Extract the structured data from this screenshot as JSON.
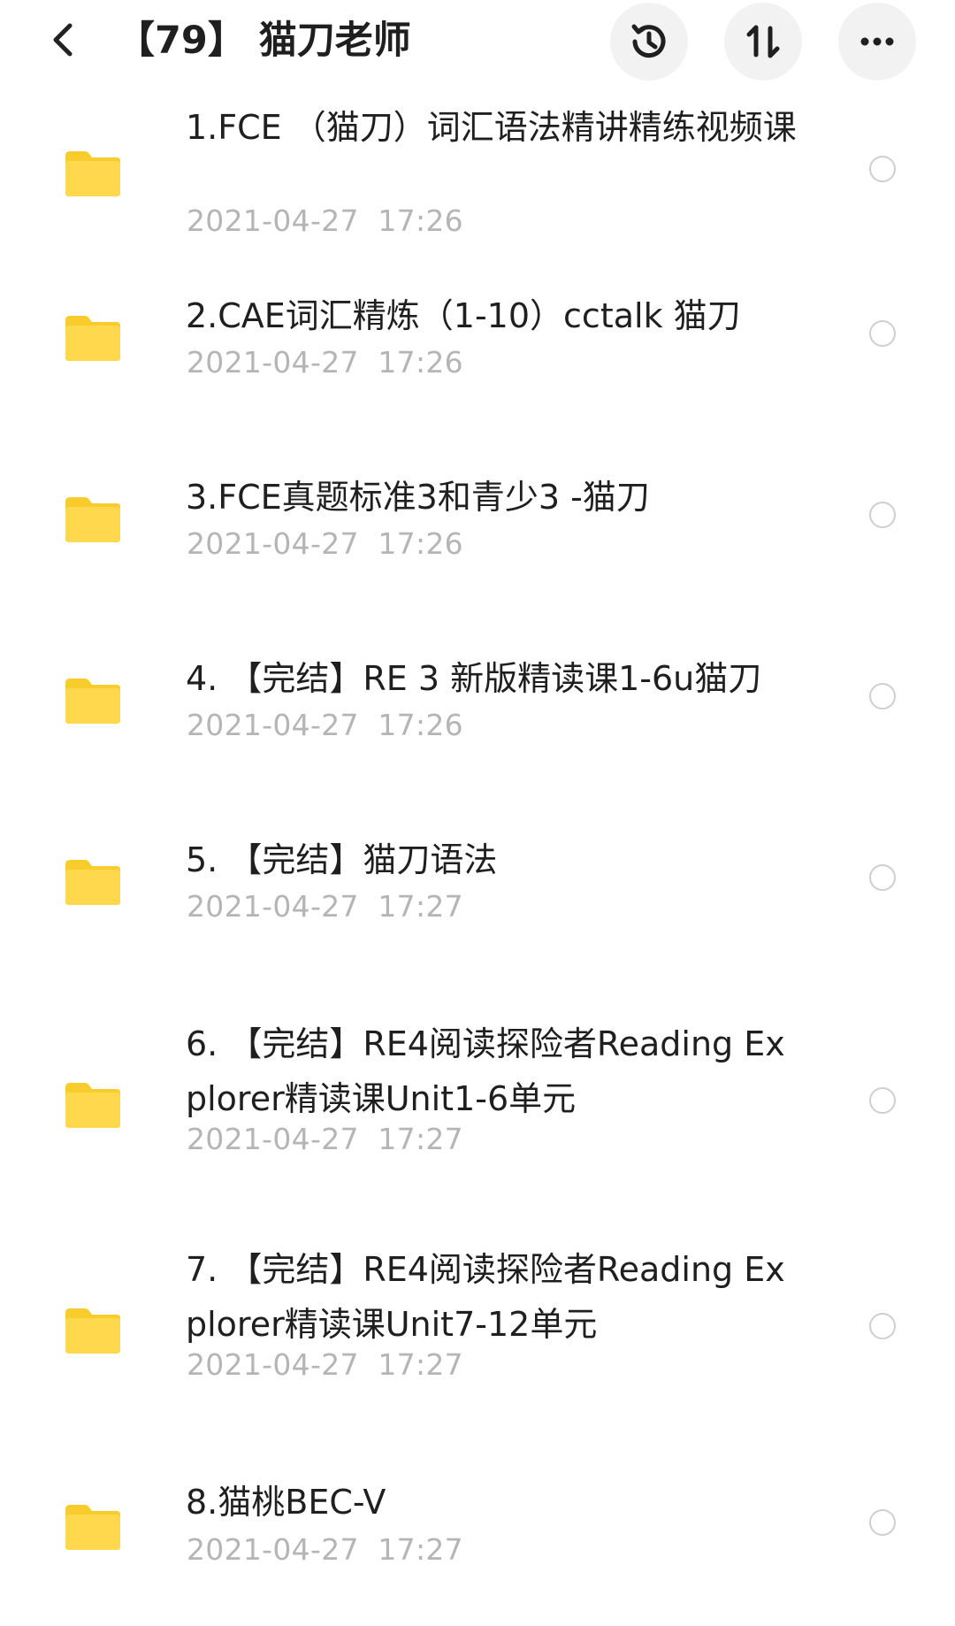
{
  "header": {
    "title": "【79】 猫刀老师",
    "back_icon": "chevron-left-icon",
    "actions": [
      {
        "name": "history-button",
        "icon": "history-icon"
      },
      {
        "name": "sort-button",
        "icon": "sort-icon"
      },
      {
        "name": "more-button",
        "icon": "more-horizontal-icon"
      }
    ]
  },
  "colors": {
    "folder": "#FFD84D",
    "folder_tab": "#F9CC2E",
    "date_text": "#B5B5B5",
    "radio_border": "#CFCFCF",
    "icon_bg": "#F2F2F2"
  },
  "files": [
    {
      "name": "1.FCE （猫刀）词汇语法精讲精练视频课",
      "date": "2021-04-27  17:26"
    },
    {
      "name": "2.CAE词汇精炼（1-10）cctalk 猫刀",
      "date": "2021-04-27  17:26"
    },
    {
      "name": "3.FCE真题标准3和青少3 -猫刀",
      "date": "2021-04-27  17:26"
    },
    {
      "name": "4. 【完结】RE 3 新版精读课1-6u猫刀",
      "date": "2021-04-27  17:26"
    },
    {
      "name": "5. 【完结】猫刀语法",
      "date": "2021-04-27  17:27"
    },
    {
      "name": "6. 【完结】RE4阅读探险者Reading Explorer精读课Unit1-6单元",
      "date": "2021-04-27  17:27"
    },
    {
      "name": "7. 【完结】RE4阅读探险者Reading Explorer精读课Unit7-12单元",
      "date": "2021-04-27  17:27"
    },
    {
      "name": "8.猫桃BEC-V",
      "date": "2021-04-27  17:27"
    }
  ]
}
